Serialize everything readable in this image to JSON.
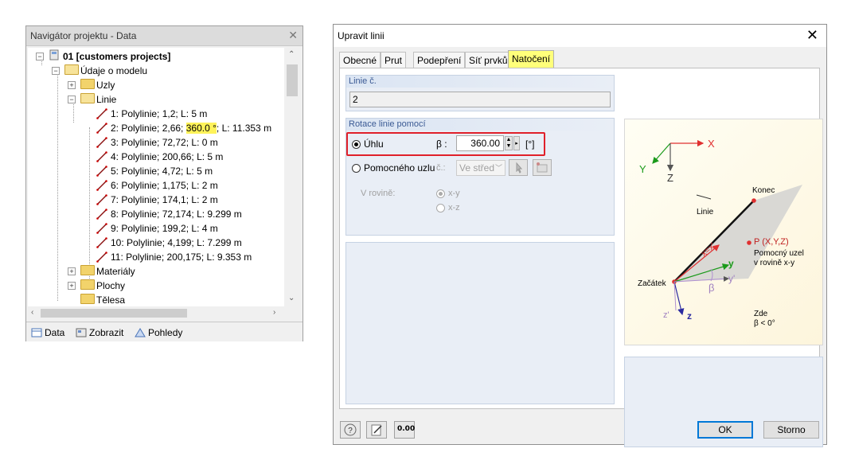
{
  "navigator": {
    "title": "Navigátor projektu - Data",
    "project": "01 [customers projects]",
    "model_data": "Údaje o modelu",
    "nodes": "Uzly",
    "lines": "Linie",
    "line_items": [
      {
        "pre": "1: Polylinie; 1,2; L: 5 m",
        "hl": "",
        "post": ""
      },
      {
        "pre": "2: Polylinie; 2,66; ",
        "hl": "360.0 °",
        "post": "; L: 11.353 m"
      },
      {
        "pre": "3: Polylinie; 72,72; L: 0 m",
        "hl": "",
        "post": ""
      },
      {
        "pre": "4: Polylinie; 200,66; L: 5 m",
        "hl": "",
        "post": ""
      },
      {
        "pre": "5: Polylinie; 4,72; L: 5 m",
        "hl": "",
        "post": ""
      },
      {
        "pre": "6: Polylinie; 1,175; L: 2 m",
        "hl": "",
        "post": ""
      },
      {
        "pre": "7: Polylinie; 174,1; L: 2 m",
        "hl": "",
        "post": ""
      },
      {
        "pre": "8: Polylinie; 72,174; L: 9.299 m",
        "hl": "",
        "post": ""
      },
      {
        "pre": "9: Polylinie; 199,2; L: 4 m",
        "hl": "",
        "post": ""
      },
      {
        "pre": "10: Polylinie; 4,199; L: 7.299 m",
        "hl": "",
        "post": ""
      },
      {
        "pre": "11: Polylinie; 200,175; L: 9.353 m",
        "hl": "",
        "post": ""
      }
    ],
    "materials": "Materiály",
    "surfaces": "Plochy",
    "solids": "Tělesa",
    "tabs": {
      "data": "Data",
      "display": "Zobrazit",
      "views": "Pohledy"
    }
  },
  "dialog": {
    "title": "Upravit linii",
    "tabs": [
      "Obecné",
      "Prut",
      "Podepření",
      "Síť prvků",
      "Natočení"
    ],
    "active_tab": "Natočení",
    "line_no_label": "Linie č.",
    "line_no_value": "2",
    "rotation_label": "Rotace linie pomocí",
    "angle_option": "Úhlu",
    "beta_label": "β :",
    "beta_value": "360.00",
    "beta_unit": "[°]",
    "helper_node_option": "Pomocného uzlu",
    "no_label": "č.:",
    "helper_select": "Ve střed",
    "in_plane_label": "V rovině:",
    "plane_options": [
      "x-y",
      "x-z"
    ],
    "ok": "OK",
    "cancel": "Storno",
    "units_icon_text": "0.00",
    "diagram": {
      "axis_x": "X",
      "axis_y": "Y",
      "axis_z": "Z",
      "end": "Konec",
      "line": "Linie",
      "start": "Začátek",
      "point": "P (X,Y,Z)",
      "helper_node": "Pomocný uzel",
      "in_plane": "v rovině x-y",
      "local_x": "x=x'",
      "local_y": "y",
      "local_y2": "y'",
      "local_z": "z",
      "local_z2": "z'",
      "beta": "β",
      "here": "Zde",
      "beta_cond": "β < 0°"
    }
  },
  "colors": {
    "highlight": "#fff35a",
    "active_tab": "#ffff7a",
    "red_box": "#e0202a",
    "accent": "#3b5a94"
  }
}
